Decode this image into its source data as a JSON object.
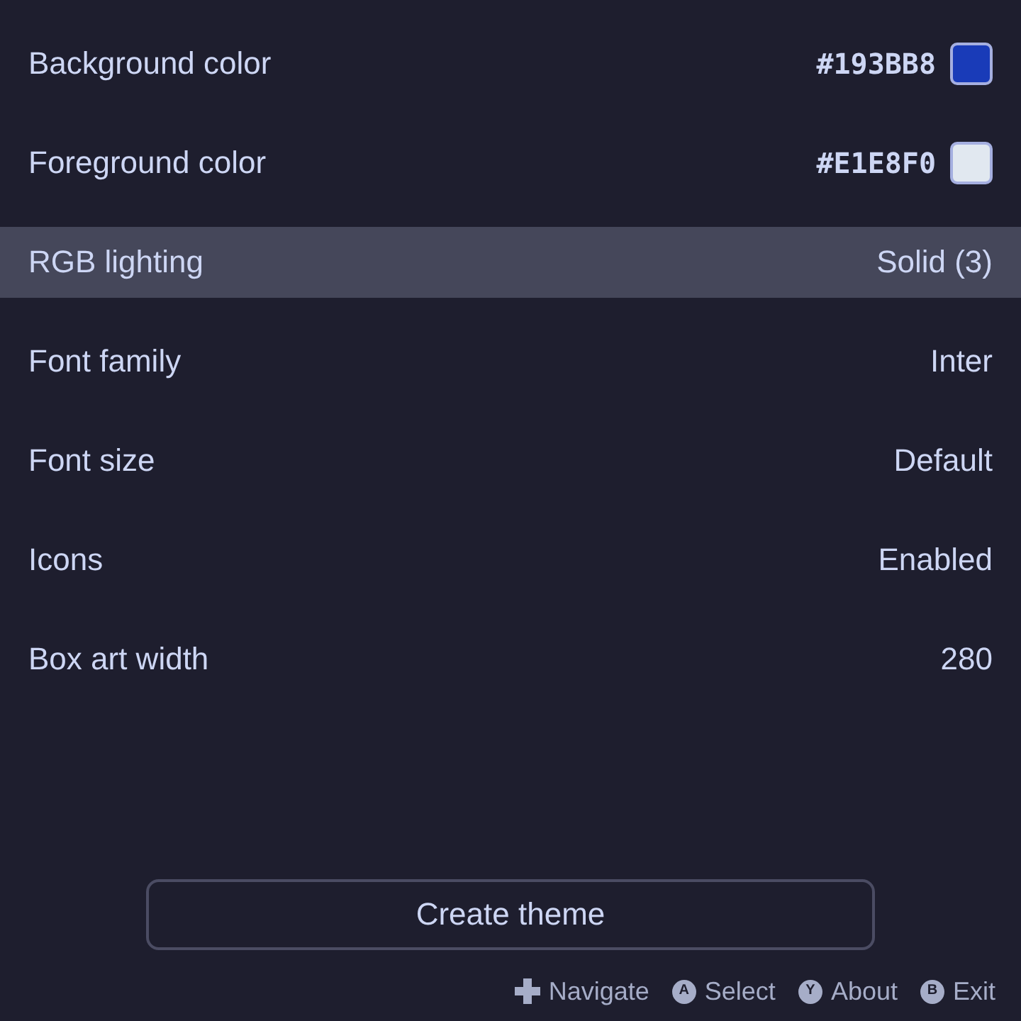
{
  "settings": [
    {
      "kind": "color",
      "label": "Background color",
      "value": "#193BB8",
      "color": "#193bb8",
      "selected": false
    },
    {
      "kind": "color",
      "label": "Foreground color",
      "value": "#E1E8F0",
      "color": "#e1e8f0",
      "selected": false
    },
    {
      "kind": "option",
      "label": "RGB lighting",
      "value": "Solid (3)",
      "selected": true
    },
    {
      "kind": "option",
      "label": "Font family",
      "value": "Inter",
      "selected": false
    },
    {
      "kind": "option",
      "label": "Font size",
      "value": "Default",
      "selected": false
    },
    {
      "kind": "option",
      "label": "Icons",
      "value": "Enabled",
      "selected": false
    },
    {
      "kind": "option",
      "label": "Box art width",
      "value": "280",
      "selected": false
    }
  ],
  "action_button": {
    "label": "Create theme"
  },
  "footer_hints": [
    {
      "kind": "dpad",
      "label": "Navigate"
    },
    {
      "kind": "key",
      "key": "A",
      "label": "Select"
    },
    {
      "kind": "key",
      "key": "Y",
      "label": "About"
    },
    {
      "kind": "key",
      "key": "B",
      "label": "Exit"
    }
  ]
}
